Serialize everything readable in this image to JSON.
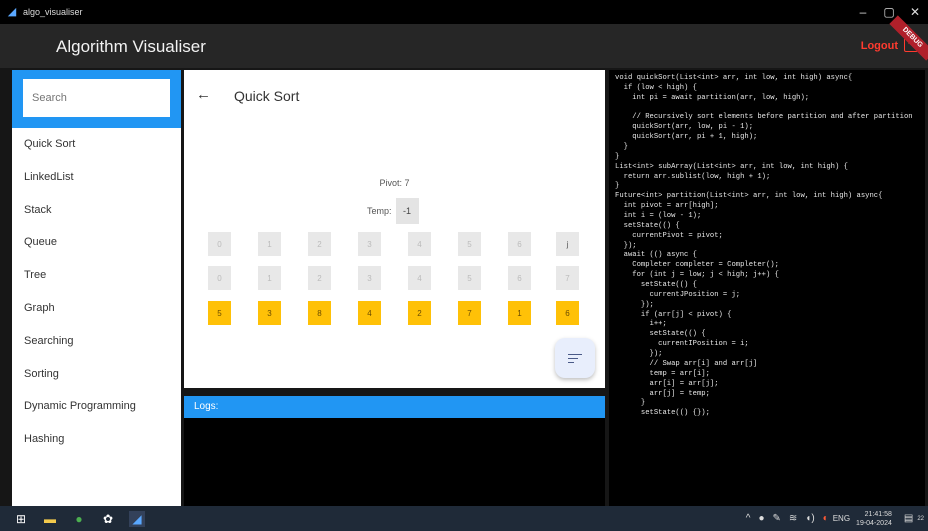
{
  "window": {
    "title": "algo_visualiser"
  },
  "appbar": {
    "title": "Algorithm Visualiser",
    "logout_label": "Logout",
    "debug_label": "DEBUG"
  },
  "sidebar": {
    "search_placeholder": "Search",
    "items": [
      {
        "label": "Quick Sort"
      },
      {
        "label": "LinkedList"
      },
      {
        "label": "Stack"
      },
      {
        "label": "Queue"
      },
      {
        "label": "Tree"
      },
      {
        "label": "Graph"
      },
      {
        "label": "Searching"
      },
      {
        "label": "Sorting"
      },
      {
        "label": "Dynamic Programming"
      },
      {
        "label": "Hashing"
      }
    ]
  },
  "main": {
    "title": "Quick Sort",
    "pivot_text": "Pivot: 7",
    "temp_label": "Temp:",
    "temp_value": "-1",
    "row_i": [
      "0",
      "1",
      "2",
      "3",
      "4",
      "5",
      "6",
      "j"
    ],
    "row_j": [
      "0",
      "1",
      "2",
      "3",
      "4",
      "5",
      "6",
      "7"
    ],
    "values": [
      "5",
      "3",
      "8",
      "4",
      "2",
      "7",
      "1",
      "6"
    ]
  },
  "logs": {
    "title": "Logs:"
  },
  "code": {
    "lines": [
      "void quickSort(List<int> arr, int low, int high) async{",
      "  if (low < high) {",
      "    int pi = await partition(arr, low, high);",
      "",
      "    // Recursively sort elements before partition and after partition",
      "    quickSort(arr, low, pi - 1);",
      "    quickSort(arr, pi + 1, high);",
      "  }",
      "}",
      "List<int> subArray(List<int> arr, int low, int high) {",
      "  return arr.sublist(low, high + 1);",
      "}",
      "Future<int> partition(List<int> arr, int low, int high) async{",
      "  int pivot = arr[high];",
      "  int i = (low - 1);",
      "  setState(() {",
      "    currentPivot = pivot;",
      "  });",
      "  await (() async {",
      "    Completer completer = Completer();",
      "    for (int j = low; j < high; j++) {",
      "      setState(() {",
      "        currentJPosition = j;",
      "      });",
      "      if (arr[j] < pivot) {",
      "        i++;",
      "        setState(() {",
      "          currentIPosition = i;",
      "        });",
      "        // Swap arr[i] and arr[j]",
      "        temp = arr[i];",
      "        arr[i] = arr[j];",
      "        arr[j] = temp;",
      "      }",
      "      setState(() {});"
    ]
  },
  "taskbar": {
    "lang": "ENG",
    "time": "21:41:58",
    "date": "19-04-2024",
    "notification_count": "22"
  },
  "colors": {
    "accent": "#2196f3",
    "cell_value": "#ffc107",
    "logout": "#ff3b2f"
  }
}
